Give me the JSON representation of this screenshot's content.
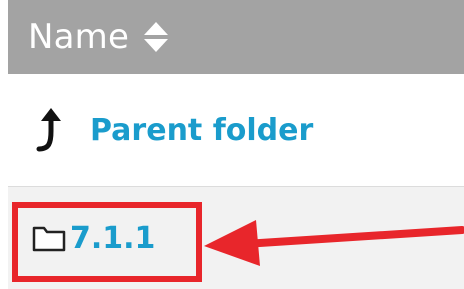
{
  "table": {
    "header": {
      "name_label": "Name",
      "sort_icon": "sort-icon"
    },
    "rows": [
      {
        "label": "Parent folder",
        "icon": "up-arrow-icon"
      },
      {
        "label": "7.1.1",
        "icon": "folder-icon"
      }
    ]
  },
  "colors": {
    "header_bg": "#a3a3a3",
    "link": "#1a9ccc",
    "highlight": "#e8262b",
    "row_alt_bg": "#f2f2f2"
  }
}
